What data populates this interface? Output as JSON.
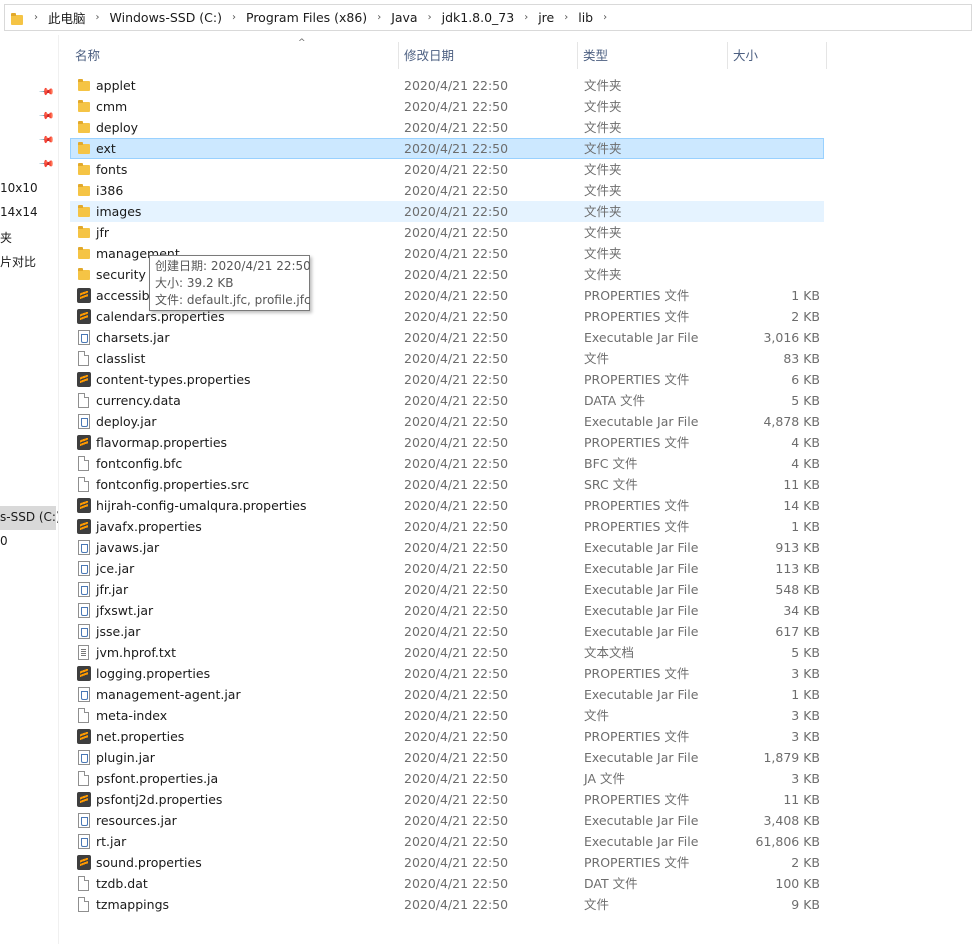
{
  "breadcrumb": [
    "此电脑",
    "Windows-SSD (C:)",
    "Program Files (x86)",
    "Java",
    "jdk1.8.0_73",
    "jre",
    "lib"
  ],
  "nav": {
    "items": [
      "10x10",
      "14x14",
      "夹",
      "片对比",
      "s-SSD (C:)",
      "0"
    ]
  },
  "columns": {
    "name": "名称",
    "date": "修改日期",
    "type": "类型",
    "size": "大小"
  },
  "files": [
    {
      "name": "applet",
      "date": "2020/4/21 22:50",
      "type": "文件夹",
      "size": "",
      "icon": "folder-icon"
    },
    {
      "name": "cmm",
      "date": "2020/4/21 22:50",
      "type": "文件夹",
      "size": "",
      "icon": "folder-icon"
    },
    {
      "name": "deploy",
      "date": "2020/4/21 22:50",
      "type": "文件夹",
      "size": "",
      "icon": "folder-icon"
    },
    {
      "name": "ext",
      "date": "2020/4/21 22:50",
      "type": "文件夹",
      "size": "",
      "icon": "folder-icon",
      "state": "selected"
    },
    {
      "name": "fonts",
      "date": "2020/4/21 22:50",
      "type": "文件夹",
      "size": "",
      "icon": "folder-icon"
    },
    {
      "name": "i386",
      "date": "2020/4/21 22:50",
      "type": "文件夹",
      "size": "",
      "icon": "folder-icon"
    },
    {
      "name": "images",
      "date": "2020/4/21 22:50",
      "type": "文件夹",
      "size": "",
      "icon": "folder-icon",
      "state": "hover"
    },
    {
      "name": "jfr",
      "date": "2020/4/21 22:50",
      "type": "文件夹",
      "size": "",
      "icon": "folder-icon"
    },
    {
      "name": "management",
      "date": "2020/4/21 22:50",
      "type": "文件夹",
      "size": "",
      "icon": "folder-icon"
    },
    {
      "name": "security",
      "date": "2020/4/21 22:50",
      "type": "文件夹",
      "size": "",
      "icon": "folder-icon"
    },
    {
      "name": "accessibi",
      "date": "2020/4/21 22:50",
      "type": "PROPERTIES 文件",
      "size": "1 KB",
      "icon": "sublime-file-icon"
    },
    {
      "name": "calendars.properties",
      "date": "2020/4/21 22:50",
      "type": "PROPERTIES 文件",
      "size": "2 KB",
      "icon": "sublime-file-icon"
    },
    {
      "name": "charsets.jar",
      "date": "2020/4/21 22:50",
      "type": "Executable Jar File",
      "size": "3,016 KB",
      "icon": "jar-file-icon"
    },
    {
      "name": "classlist",
      "date": "2020/4/21 22:50",
      "type": "文件",
      "size": "83 KB",
      "icon": "blank-file-icon"
    },
    {
      "name": "content-types.properties",
      "date": "2020/4/21 22:50",
      "type": "PROPERTIES 文件",
      "size": "6 KB",
      "icon": "sublime-file-icon"
    },
    {
      "name": "currency.data",
      "date": "2020/4/21 22:50",
      "type": "DATA 文件",
      "size": "5 KB",
      "icon": "blank-file-icon"
    },
    {
      "name": "deploy.jar",
      "date": "2020/4/21 22:50",
      "type": "Executable Jar File",
      "size": "4,878 KB",
      "icon": "jar-file-icon"
    },
    {
      "name": "flavormap.properties",
      "date": "2020/4/21 22:50",
      "type": "PROPERTIES 文件",
      "size": "4 KB",
      "icon": "sublime-file-icon"
    },
    {
      "name": "fontconfig.bfc",
      "date": "2020/4/21 22:50",
      "type": "BFC 文件",
      "size": "4 KB",
      "icon": "blank-file-icon"
    },
    {
      "name": "fontconfig.properties.src",
      "date": "2020/4/21 22:50",
      "type": "SRC 文件",
      "size": "11 KB",
      "icon": "blank-file-icon"
    },
    {
      "name": "hijrah-config-umalqura.properties",
      "date": "2020/4/21 22:50",
      "type": "PROPERTIES 文件",
      "size": "14 KB",
      "icon": "sublime-file-icon"
    },
    {
      "name": "javafx.properties",
      "date": "2020/4/21 22:50",
      "type": "PROPERTIES 文件",
      "size": "1 KB",
      "icon": "sublime-file-icon"
    },
    {
      "name": "javaws.jar",
      "date": "2020/4/21 22:50",
      "type": "Executable Jar File",
      "size": "913 KB",
      "icon": "jar-file-icon"
    },
    {
      "name": "jce.jar",
      "date": "2020/4/21 22:50",
      "type": "Executable Jar File",
      "size": "113 KB",
      "icon": "jar-file-icon"
    },
    {
      "name": "jfr.jar",
      "date": "2020/4/21 22:50",
      "type": "Executable Jar File",
      "size": "548 KB",
      "icon": "jar-file-icon"
    },
    {
      "name": "jfxswt.jar",
      "date": "2020/4/21 22:50",
      "type": "Executable Jar File",
      "size": "34 KB",
      "icon": "jar-file-icon"
    },
    {
      "name": "jsse.jar",
      "date": "2020/4/21 22:50",
      "type": "Executable Jar File",
      "size": "617 KB",
      "icon": "jar-file-icon"
    },
    {
      "name": "jvm.hprof.txt",
      "date": "2020/4/21 22:50",
      "type": "文本文档",
      "size": "5 KB",
      "icon": "text-file-icon"
    },
    {
      "name": "logging.properties",
      "date": "2020/4/21 22:50",
      "type": "PROPERTIES 文件",
      "size": "3 KB",
      "icon": "sublime-file-icon"
    },
    {
      "name": "management-agent.jar",
      "date": "2020/4/21 22:50",
      "type": "Executable Jar File",
      "size": "1 KB",
      "icon": "jar-file-icon"
    },
    {
      "name": "meta-index",
      "date": "2020/4/21 22:50",
      "type": "文件",
      "size": "3 KB",
      "icon": "blank-file-icon"
    },
    {
      "name": "net.properties",
      "date": "2020/4/21 22:50",
      "type": "PROPERTIES 文件",
      "size": "3 KB",
      "icon": "sublime-file-icon"
    },
    {
      "name": "plugin.jar",
      "date": "2020/4/21 22:50",
      "type": "Executable Jar File",
      "size": "1,879 KB",
      "icon": "jar-file-icon"
    },
    {
      "name": "psfont.properties.ja",
      "date": "2020/4/21 22:50",
      "type": "JA 文件",
      "size": "3 KB",
      "icon": "blank-file-icon"
    },
    {
      "name": "psfontj2d.properties",
      "date": "2020/4/21 22:50",
      "type": "PROPERTIES 文件",
      "size": "11 KB",
      "icon": "sublime-file-icon"
    },
    {
      "name": "resources.jar",
      "date": "2020/4/21 22:50",
      "type": "Executable Jar File",
      "size": "3,408 KB",
      "icon": "jar-file-icon"
    },
    {
      "name": "rt.jar",
      "date": "2020/4/21 22:50",
      "type": "Executable Jar File",
      "size": "61,806 KB",
      "icon": "jar-file-icon"
    },
    {
      "name": "sound.properties",
      "date": "2020/4/21 22:50",
      "type": "PROPERTIES 文件",
      "size": "2 KB",
      "icon": "sublime-file-icon"
    },
    {
      "name": "tzdb.dat",
      "date": "2020/4/21 22:50",
      "type": "DAT 文件",
      "size": "100 KB",
      "icon": "blank-file-icon"
    },
    {
      "name": "tzmappings",
      "date": "2020/4/21 22:50",
      "type": "文件",
      "size": "9 KB",
      "icon": "blank-file-icon"
    }
  ],
  "tooltip": {
    "created": "创建日期: 2020/4/21 22:50",
    "size": "大小: 39.2 KB",
    "files": "文件: default.jfc, profile.jfc"
  },
  "colors": {
    "selected_bg": "#cce8ff",
    "hover_bg": "#e5f3ff",
    "header_text": "#4d6082",
    "folder": "#f5c445"
  }
}
